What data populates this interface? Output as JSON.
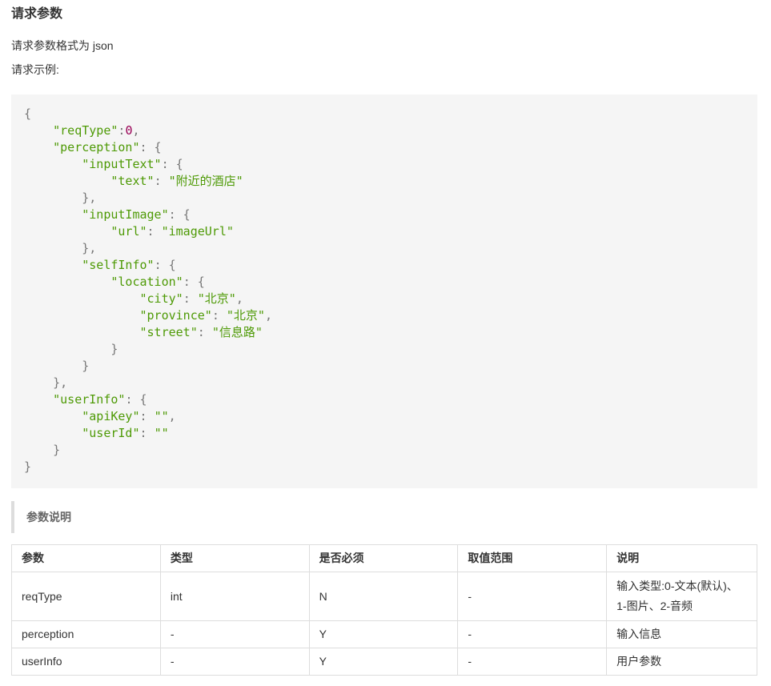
{
  "section": {
    "title": "请求参数",
    "format_text": "请求参数格式为 json",
    "example_label": "请求示例:"
  },
  "code": {
    "tokens": [
      [
        [
          "p",
          "{"
        ]
      ],
      [
        [
          "s",
          "    "
        ],
        [
          "k",
          "\"reqType\""
        ],
        [
          "p",
          ":"
        ],
        [
          "n",
          "0"
        ],
        [
          "p",
          ","
        ]
      ],
      [
        [
          "s",
          "    "
        ],
        [
          "k",
          "\"perception\""
        ],
        [
          "p",
          ": {"
        ]
      ],
      [
        [
          "s",
          "        "
        ],
        [
          "k",
          "\"inputText\""
        ],
        [
          "p",
          ": {"
        ]
      ],
      [
        [
          "s",
          "            "
        ],
        [
          "k",
          "\"text\""
        ],
        [
          "p",
          ": "
        ],
        [
          "v",
          "\"附近的酒店\""
        ]
      ],
      [
        [
          "s",
          "        "
        ],
        [
          "p",
          "},"
        ]
      ],
      [
        [
          "s",
          "        "
        ],
        [
          "k",
          "\"inputImage\""
        ],
        [
          "p",
          ": {"
        ]
      ],
      [
        [
          "s",
          "            "
        ],
        [
          "k",
          "\"url\""
        ],
        [
          "p",
          ": "
        ],
        [
          "v",
          "\"imageUrl\""
        ]
      ],
      [
        [
          "s",
          "        "
        ],
        [
          "p",
          "},"
        ]
      ],
      [
        [
          "s",
          "        "
        ],
        [
          "k",
          "\"selfInfo\""
        ],
        [
          "p",
          ": {"
        ]
      ],
      [
        [
          "s",
          "            "
        ],
        [
          "k",
          "\"location\""
        ],
        [
          "p",
          ": {"
        ]
      ],
      [
        [
          "s",
          "                "
        ],
        [
          "k",
          "\"city\""
        ],
        [
          "p",
          ": "
        ],
        [
          "v",
          "\"北京\""
        ],
        [
          "p",
          ","
        ]
      ],
      [
        [
          "s",
          "                "
        ],
        [
          "k",
          "\"province\""
        ],
        [
          "p",
          ": "
        ],
        [
          "v",
          "\"北京\""
        ],
        [
          "p",
          ","
        ]
      ],
      [
        [
          "s",
          "                "
        ],
        [
          "k",
          "\"street\""
        ],
        [
          "p",
          ": "
        ],
        [
          "v",
          "\"信息路\""
        ]
      ],
      [
        [
          "s",
          "            "
        ],
        [
          "p",
          "}"
        ]
      ],
      [
        [
          "s",
          "        "
        ],
        [
          "p",
          "}"
        ]
      ],
      [
        [
          "s",
          "    "
        ],
        [
          "p",
          "},"
        ]
      ],
      [
        [
          "s",
          "    "
        ],
        [
          "k",
          "\"userInfo\""
        ],
        [
          "p",
          ": {"
        ]
      ],
      [
        [
          "s",
          "        "
        ],
        [
          "k",
          "\"apiKey\""
        ],
        [
          "p",
          ": "
        ],
        [
          "v",
          "\"\""
        ],
        [
          "p",
          ","
        ]
      ],
      [
        [
          "s",
          "        "
        ],
        [
          "k",
          "\"userId\""
        ],
        [
          "p",
          ": "
        ],
        [
          "v",
          "\"\""
        ]
      ],
      [
        [
          "s",
          "    "
        ],
        [
          "p",
          "}"
        ]
      ],
      [
        [
          "p",
          "}"
        ]
      ]
    ]
  },
  "params_section": {
    "title": "参数说明"
  },
  "table": {
    "headers": [
      "参数",
      "类型",
      "是否必须",
      "取值范围",
      "说明"
    ],
    "rows": [
      [
        "reqType",
        "int",
        "N",
        "-",
        "输入类型:0-文本(默认)、1-图片、2-音频"
      ],
      [
        "perception",
        "-",
        "Y",
        "-",
        "输入信息"
      ],
      [
        "userInfo",
        "-",
        "Y",
        "-",
        "用户参数"
      ]
    ]
  },
  "colors": {
    "code_background": "#f5f5f5",
    "code_string": "#4e9a06",
    "code_number": "#990055",
    "border": "#dddddd"
  }
}
